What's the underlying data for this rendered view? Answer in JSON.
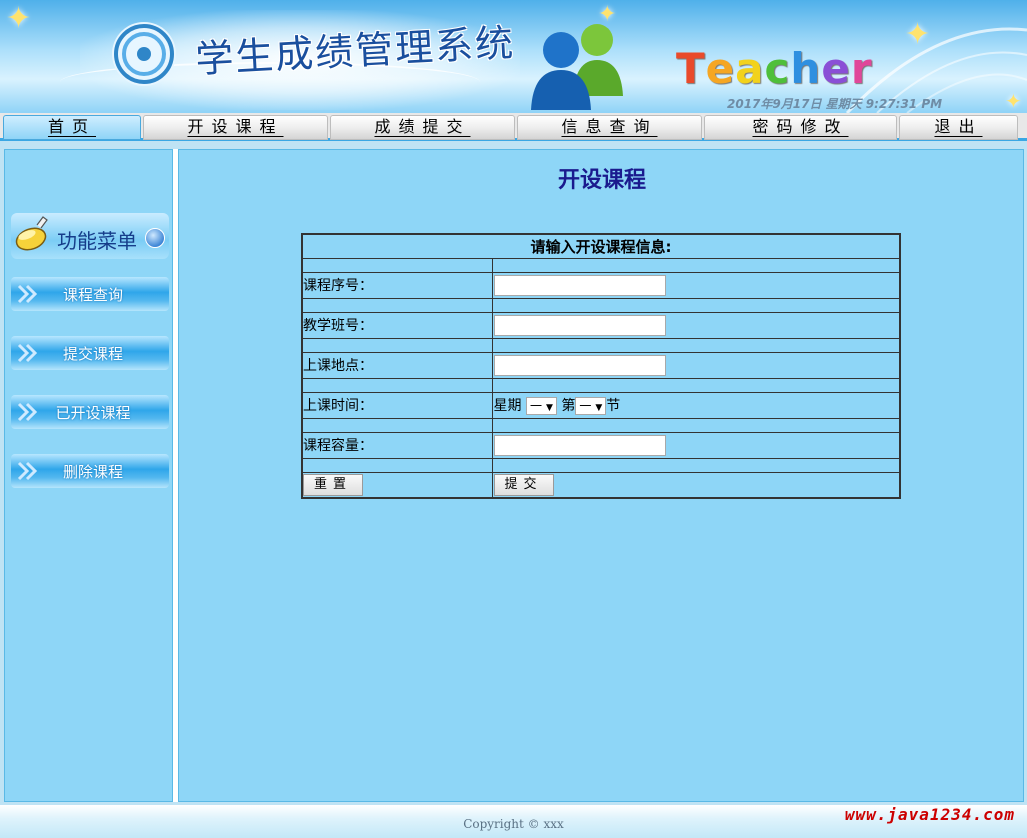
{
  "header": {
    "app_title": "学生成绩管理系统",
    "role_word": [
      "T",
      "e",
      "a",
      "c",
      "h",
      "e",
      "r"
    ],
    "role_colors": [
      "#e94a2b",
      "#f5a623",
      "#f2d21c",
      "#4fbf3a",
      "#2e8fe0",
      "#8a4fd6",
      "#e0479a"
    ],
    "clock": "2017年9月17日 星期天 9:27:31 PM"
  },
  "nav": {
    "tabs": [
      {
        "label": "首页",
        "active": true
      },
      {
        "label": "开设课程",
        "active": false
      },
      {
        "label": "成绩提交",
        "active": false
      },
      {
        "label": "信息查询",
        "active": false
      },
      {
        "label": "密码修改",
        "active": false
      },
      {
        "label": "退出",
        "active": false
      }
    ]
  },
  "sidebar": {
    "menu_title": "功能菜单",
    "items": [
      {
        "label": "课程查询"
      },
      {
        "label": "提交课程"
      },
      {
        "label": "已开设课程"
      },
      {
        "label": "删除课程"
      }
    ]
  },
  "main": {
    "heading": "开设课程",
    "form_title": "请输入开设课程信息:",
    "fields": {
      "course_no": {
        "label": "课程序号：",
        "value": ""
      },
      "class_no": {
        "label": "教学班号：",
        "value": ""
      },
      "location": {
        "label": "上课地点：",
        "value": ""
      },
      "time": {
        "label": "上课时间：",
        "weekday_prefix": "星期",
        "weekday_value": "一",
        "period_prefix": "第",
        "period_value": "一",
        "period_suffix": "节"
      },
      "capacity": {
        "label": "课程容量：",
        "value": ""
      }
    },
    "reset_label": "重置",
    "submit_label": "提交"
  },
  "footer": {
    "copyright": "Copyright © xxx",
    "watermark": "www.java1234.com"
  }
}
